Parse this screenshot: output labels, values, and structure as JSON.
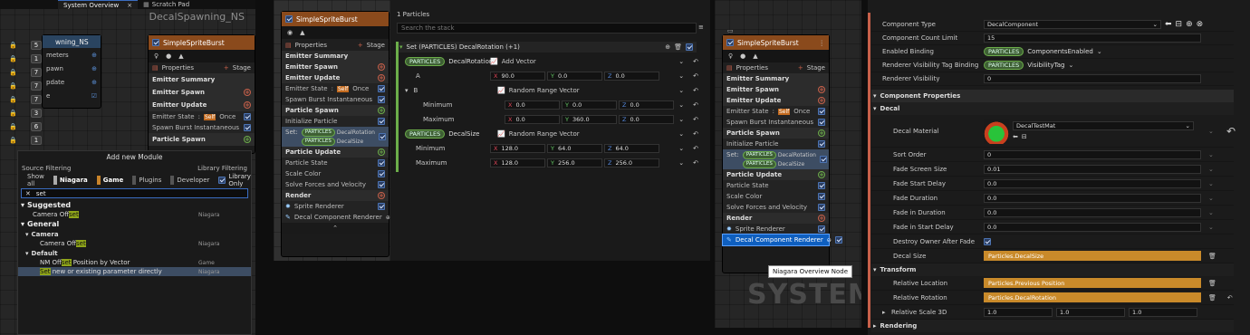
{
  "tabs": [
    {
      "label": "System Overview"
    },
    {
      "label": "Scratch Pad"
    }
  ],
  "left": {
    "graph_title": "DecalSpawning_NS",
    "badge_numbers": [
      "5",
      "1",
      "7",
      "7",
      "7",
      "3",
      "6",
      "1"
    ],
    "partial_node": {
      "title": "wning_NS",
      "rows": [
        "meters",
        "pawn",
        "pdate",
        "e"
      ]
    },
    "node": {
      "title": "SimpleSpriteBurst",
      "properties": "Properties",
      "stage": "Stage",
      "summary": "Emitter Summary",
      "spawn": "Emitter Spawn",
      "update": "Emitter Update",
      "state": "Emitter State",
      "self": "Self",
      "once": "Once",
      "burst": "Spawn Burst Instantaneous",
      "pspawn": "Particle Spawn"
    },
    "module_popup": {
      "title": "Add new Module",
      "source_filtering": "Source Filtering",
      "library_filtering": "Library Filtering",
      "filters": [
        "Show all",
        "Niagara",
        "Game",
        "Plugins",
        "Developer"
      ],
      "library_only": "Library Only",
      "search_value": "set",
      "groups": [
        {
          "header": "Suggested",
          "items": [
            {
              "pre": "Camera Off",
              "hl": "set",
              "post": "",
              "src": "Niagara",
              "indent": 1
            }
          ]
        },
        {
          "header": "General",
          "sub": [
            {
              "header": "Camera",
              "items": [
                {
                  "pre": "Camera Off",
                  "hl": "set",
                  "post": "",
                  "src": "Niagara"
                }
              ]
            },
            {
              "header": "Default",
              "items": [
                {
                  "pre": "NM Off",
                  "hl": "set",
                  "post": " Position by Vector",
                  "src": "Game"
                },
                {
                  "pre": "",
                  "hl": "Set",
                  "post": " new or existing parameter directly",
                  "src": "Niagara",
                  "selected": true
                }
              ]
            }
          ]
        }
      ]
    }
  },
  "mid": {
    "node": {
      "title": "SimpleSpriteBurst",
      "properties": "Properties",
      "stage": "Stage",
      "rows": [
        {
          "t": "sec",
          "label": "Emitter Summary"
        },
        {
          "t": "sec",
          "label": "Emitter Spawn",
          "plus": "r"
        },
        {
          "t": "sec",
          "label": "Emitter Update",
          "plus": "r"
        },
        {
          "t": "state",
          "label": "Emitter State",
          "self": "Self",
          "once": "Once"
        },
        {
          "t": "item",
          "label": "Spawn Burst Instantaneous",
          "cb": true
        },
        {
          "t": "sec",
          "label": "Particle Spawn",
          "plus": "g"
        },
        {
          "t": "item",
          "label": "Initialize Particle",
          "cb": true
        },
        {
          "t": "set",
          "label": "Set:",
          "p1": "PARTICLES",
          "v1": "DecalRotation",
          "p2": "PARTICLES",
          "v2": "DecalSize"
        },
        {
          "t": "sec",
          "label": "Particle Update",
          "plus": "g"
        },
        {
          "t": "item",
          "label": "Particle State",
          "cb": true
        },
        {
          "t": "item",
          "label": "Scale Color",
          "cb": true
        },
        {
          "t": "item",
          "label": "Solve Forces and Velocity",
          "cb": true
        },
        {
          "t": "sec",
          "label": "Render",
          "plus": "r"
        },
        {
          "t": "item",
          "label": "Sprite Renderer",
          "cb": true,
          "icon": "sun"
        },
        {
          "t": "item",
          "label": "Decal Component Renderer",
          "cb": true,
          "icon": "drop"
        }
      ]
    }
  },
  "stack": {
    "count": "1 Particles",
    "search_placeholder": "Search the stack",
    "module_title": "Set (PARTICLES) DecalRotation (+1)",
    "rotation": {
      "tag": "PARTICLES",
      "name": "DecalRotation",
      "fn": "Add Vector",
      "a": {
        "label": "A",
        "x": "90.0",
        "y": "0.0",
        "z": "0.0"
      },
      "b": {
        "label": "B",
        "fn": "Random Range Vector",
        "min": {
          "label": "Minimum",
          "x": "0.0",
          "y": "0.0",
          "z": "0.0"
        },
        "max": {
          "label": "Maximum",
          "x": "0.0",
          "y": "360.0",
          "z": "0.0"
        }
      }
    },
    "size": {
      "tag": "PARTICLES",
      "name": "DecalSize",
      "fn": "Random Range Vector",
      "min": {
        "label": "Minimum",
        "x": "128.0",
        "y": "64.0",
        "z": "64.0"
      },
      "max": {
        "label": "Maximum",
        "x": "128.0",
        "y": "256.0",
        "z": "256.0"
      }
    }
  },
  "overview": {
    "watermark": "SYSTEM",
    "tooltip": "Niagara Overview Node",
    "node": {
      "title": "SimpleSpriteBurst",
      "properties": "Properties",
      "stage": "Stage",
      "rows": [
        {
          "t": "sec",
          "label": "Emitter Summary"
        },
        {
          "t": "sec",
          "label": "Emitter Spawn",
          "plus": "r"
        },
        {
          "t": "sec",
          "label": "Emitter Update",
          "plus": "r"
        },
        {
          "t": "state",
          "label": "Emitter State",
          "self": "Self",
          "once": "Once"
        },
        {
          "t": "item",
          "label": "Spawn Burst Instantaneous",
          "cb": true
        },
        {
          "t": "sec",
          "label": "Particle Spawn",
          "plus": "g"
        },
        {
          "t": "item",
          "label": "Initialize Particle",
          "cb": true
        },
        {
          "t": "set",
          "label": "Set:",
          "p1": "PARTICLES",
          "v1": "DecalRotation",
          "p2": "PARTICLES",
          "v2": "DecalSize"
        },
        {
          "t": "sec",
          "label": "Particle Update",
          "plus": "g"
        },
        {
          "t": "item",
          "label": "Particle State",
          "cb": true
        },
        {
          "t": "item",
          "label": "Scale Color",
          "cb": true
        },
        {
          "t": "item",
          "label": "Solve Forces and Velocity",
          "cb": true
        },
        {
          "t": "sec",
          "label": "Render",
          "plus": "r"
        },
        {
          "t": "item",
          "label": "Sprite Renderer",
          "cb": true,
          "icon": "sun"
        },
        {
          "t": "item",
          "label": "Decal Component Renderer",
          "cb": true,
          "icon": "drop",
          "selected": true
        }
      ]
    }
  },
  "details": {
    "top": [
      {
        "label": "Component Type",
        "value": "DecalComponent",
        "kind": "dropdown"
      },
      {
        "label": "Component Count Limit",
        "value": "15",
        "kind": "input"
      },
      {
        "label": "Enabled Binding",
        "tag": "PARTICLES",
        "value": "ComponentsEnabled",
        "kind": "binding"
      },
      {
        "label": "Renderer Visibility Tag Binding",
        "tag": "PARTICLES",
        "value": "VisibilityTag",
        "kind": "binding"
      },
      {
        "label": "Renderer Visibility",
        "value": "0",
        "kind": "input"
      }
    ],
    "component_properties": "Component Properties",
    "decal": "Decal",
    "decal_material": {
      "label": "Decal Material",
      "value": "DecalTestMat"
    },
    "decal_rows": [
      {
        "label": "Sort Order",
        "value": "0"
      },
      {
        "label": "Fade Screen Size",
        "value": "0.01"
      },
      {
        "label": "Fade Start Delay",
        "value": "0.0"
      },
      {
        "label": "Fade Duration",
        "value": "0.0"
      },
      {
        "label": "Fade in Duration",
        "value": "0.0"
      },
      {
        "label": "Fade in Start Delay",
        "value": "0.0"
      }
    ],
    "destroy_owner": "Destroy Owner After Fade",
    "decal_size": {
      "label": "Decal Size",
      "value": "Particles.DecalSize"
    },
    "transform": "Transform",
    "rel_location": {
      "label": "Relative Location",
      "value": "Particles.Previous Position"
    },
    "rel_rotation": {
      "label": "Relative Rotation",
      "value": "Particles.DecalRotation"
    },
    "rel_scale": {
      "label": "Relative Scale 3D",
      "x": "1.0",
      "y": "1.0",
      "z": "1.0"
    },
    "rendering": "Rendering"
  }
}
